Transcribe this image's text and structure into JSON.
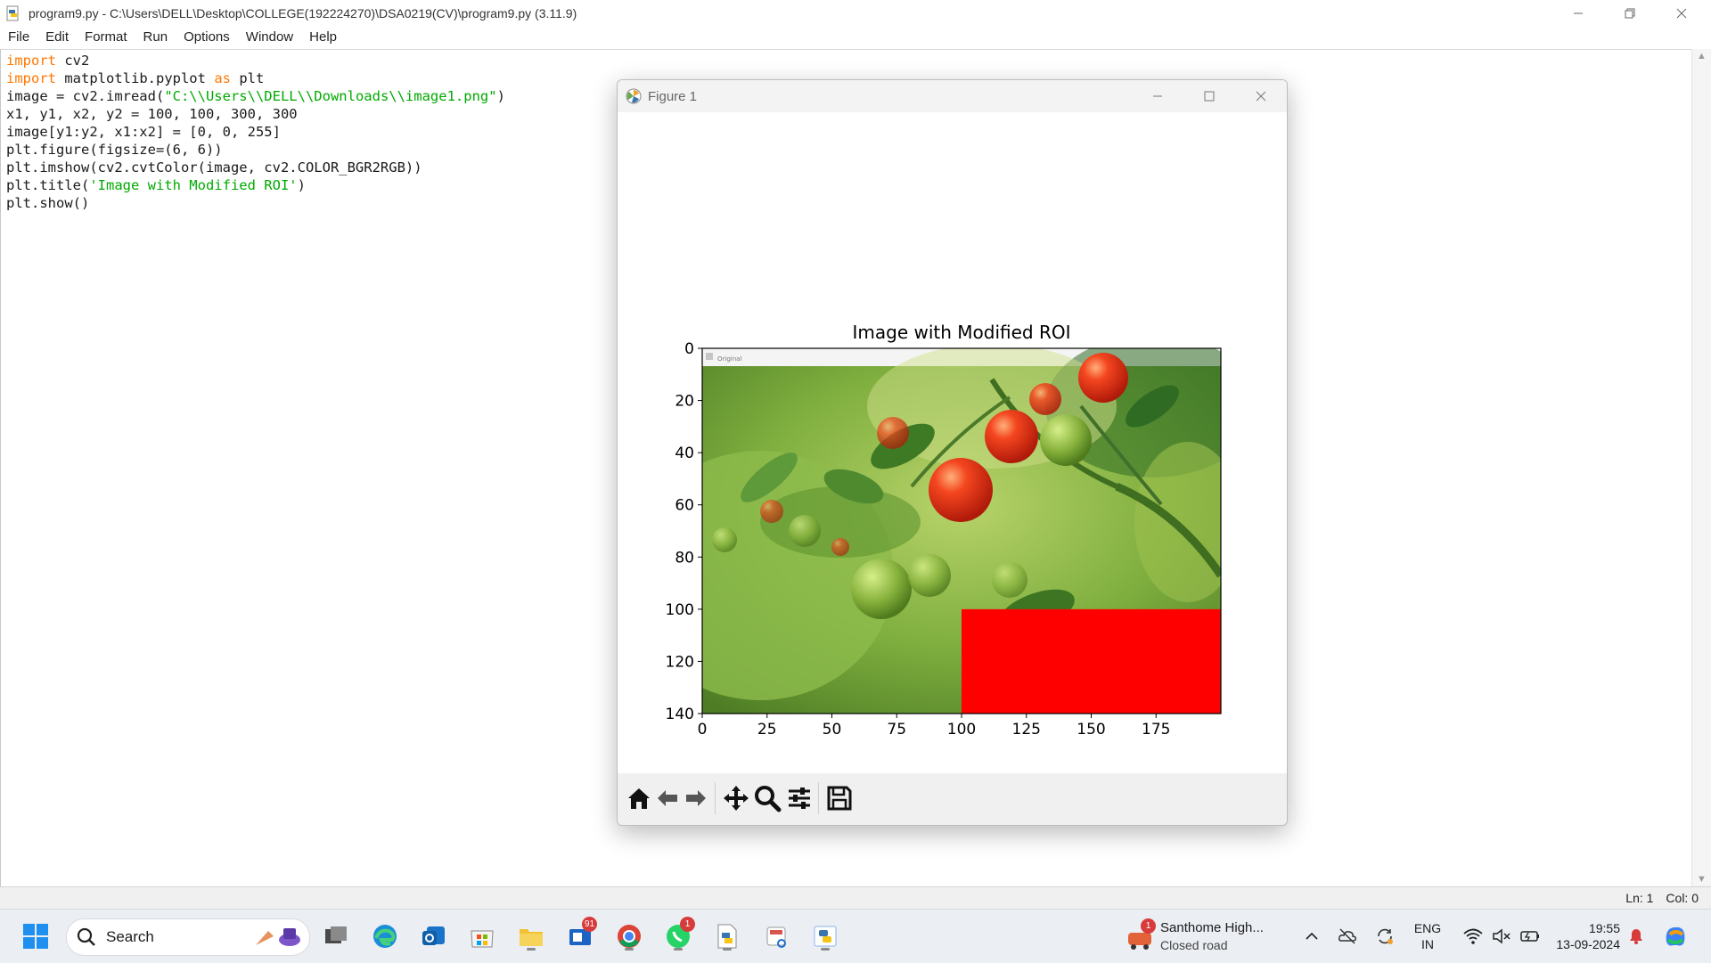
{
  "idle": {
    "title": "program9.py - C:\\Users\\DELL\\Desktop\\COLLEGE(192224270)\\DSA0219(CV)\\program9.py (3.11.9)",
    "menu": [
      "File",
      "Edit",
      "Format",
      "Run",
      "Options",
      "Window",
      "Help"
    ],
    "code_lines": [
      [
        {
          "t": "import",
          "c": "kw"
        },
        {
          "t": " cv2",
          "c": ""
        }
      ],
      [
        {
          "t": "import",
          "c": "kw"
        },
        {
          "t": " matplotlib.pyplot ",
          "c": ""
        },
        {
          "t": "as",
          "c": "kw"
        },
        {
          "t": " plt",
          "c": ""
        }
      ],
      [
        {
          "t": "image = cv2.imread(",
          "c": ""
        },
        {
          "t": "\"C:\\\\Users\\\\DELL\\\\Downloads\\\\image1.png\"",
          "c": "str"
        },
        {
          "t": ")",
          "c": ""
        }
      ],
      [
        {
          "t": "x1, y1, x2, y2 = 100, 100, 300, 300",
          "c": ""
        }
      ],
      [
        {
          "t": "image[y1:y2, x1:x2] = [0, 0, 255]",
          "c": ""
        }
      ],
      [
        {
          "t": "plt.figure(figsize=(6, 6))",
          "c": ""
        }
      ],
      [
        {
          "t": "plt.imshow(cv2.cvtColor(image, cv2.COLOR_BGR2RGB))",
          "c": ""
        }
      ],
      [
        {
          "t": "plt.title(",
          "c": ""
        },
        {
          "t": "'Image with Modified ROI'",
          "c": "str"
        },
        {
          "t": ")",
          "c": ""
        }
      ],
      [
        {
          "t": "plt.show()",
          "c": ""
        }
      ]
    ],
    "status_line": "Ln: 1",
    "status_col": "Col: 0"
  },
  "figure": {
    "window_title": "Figure 1",
    "plot_title": "Image with Modified ROI",
    "inner_window_title": "Original",
    "xticks": [
      "0",
      "25",
      "50",
      "75",
      "100",
      "125",
      "150",
      "175"
    ],
    "yticks": [
      "0",
      "20",
      "40",
      "60",
      "80",
      "100",
      "120",
      "140"
    ],
    "toolbar": [
      "home-icon",
      "back-arrow-icon",
      "forward-arrow-icon",
      "pan-icon",
      "zoom-icon",
      "configure-subplots-icon",
      "save-icon"
    ],
    "roi_color": "#ff0000"
  },
  "taskbar": {
    "search_label": "Search",
    "outlook_badge": "91",
    "whatsapp_badge": "1",
    "weather_badge": "1",
    "weather_title": "Santhome High...",
    "weather_sub": "Closed road",
    "lang1": "ENG",
    "lang2": "IN",
    "time": "19:55",
    "date": "13-09-2024"
  },
  "chart_data": {
    "type": "image",
    "title": "Image with Modified ROI",
    "xlim": [
      0,
      200
    ],
    "ylim": [
      140,
      0
    ],
    "xticks": [
      0,
      25,
      50,
      75,
      100,
      125,
      150,
      175
    ],
    "yticks": [
      0,
      20,
      40,
      60,
      80,
      100,
      120,
      140
    ],
    "roi": {
      "x": [
        100,
        200
      ],
      "y": [
        100,
        140
      ],
      "color": "#ff0000"
    }
  }
}
